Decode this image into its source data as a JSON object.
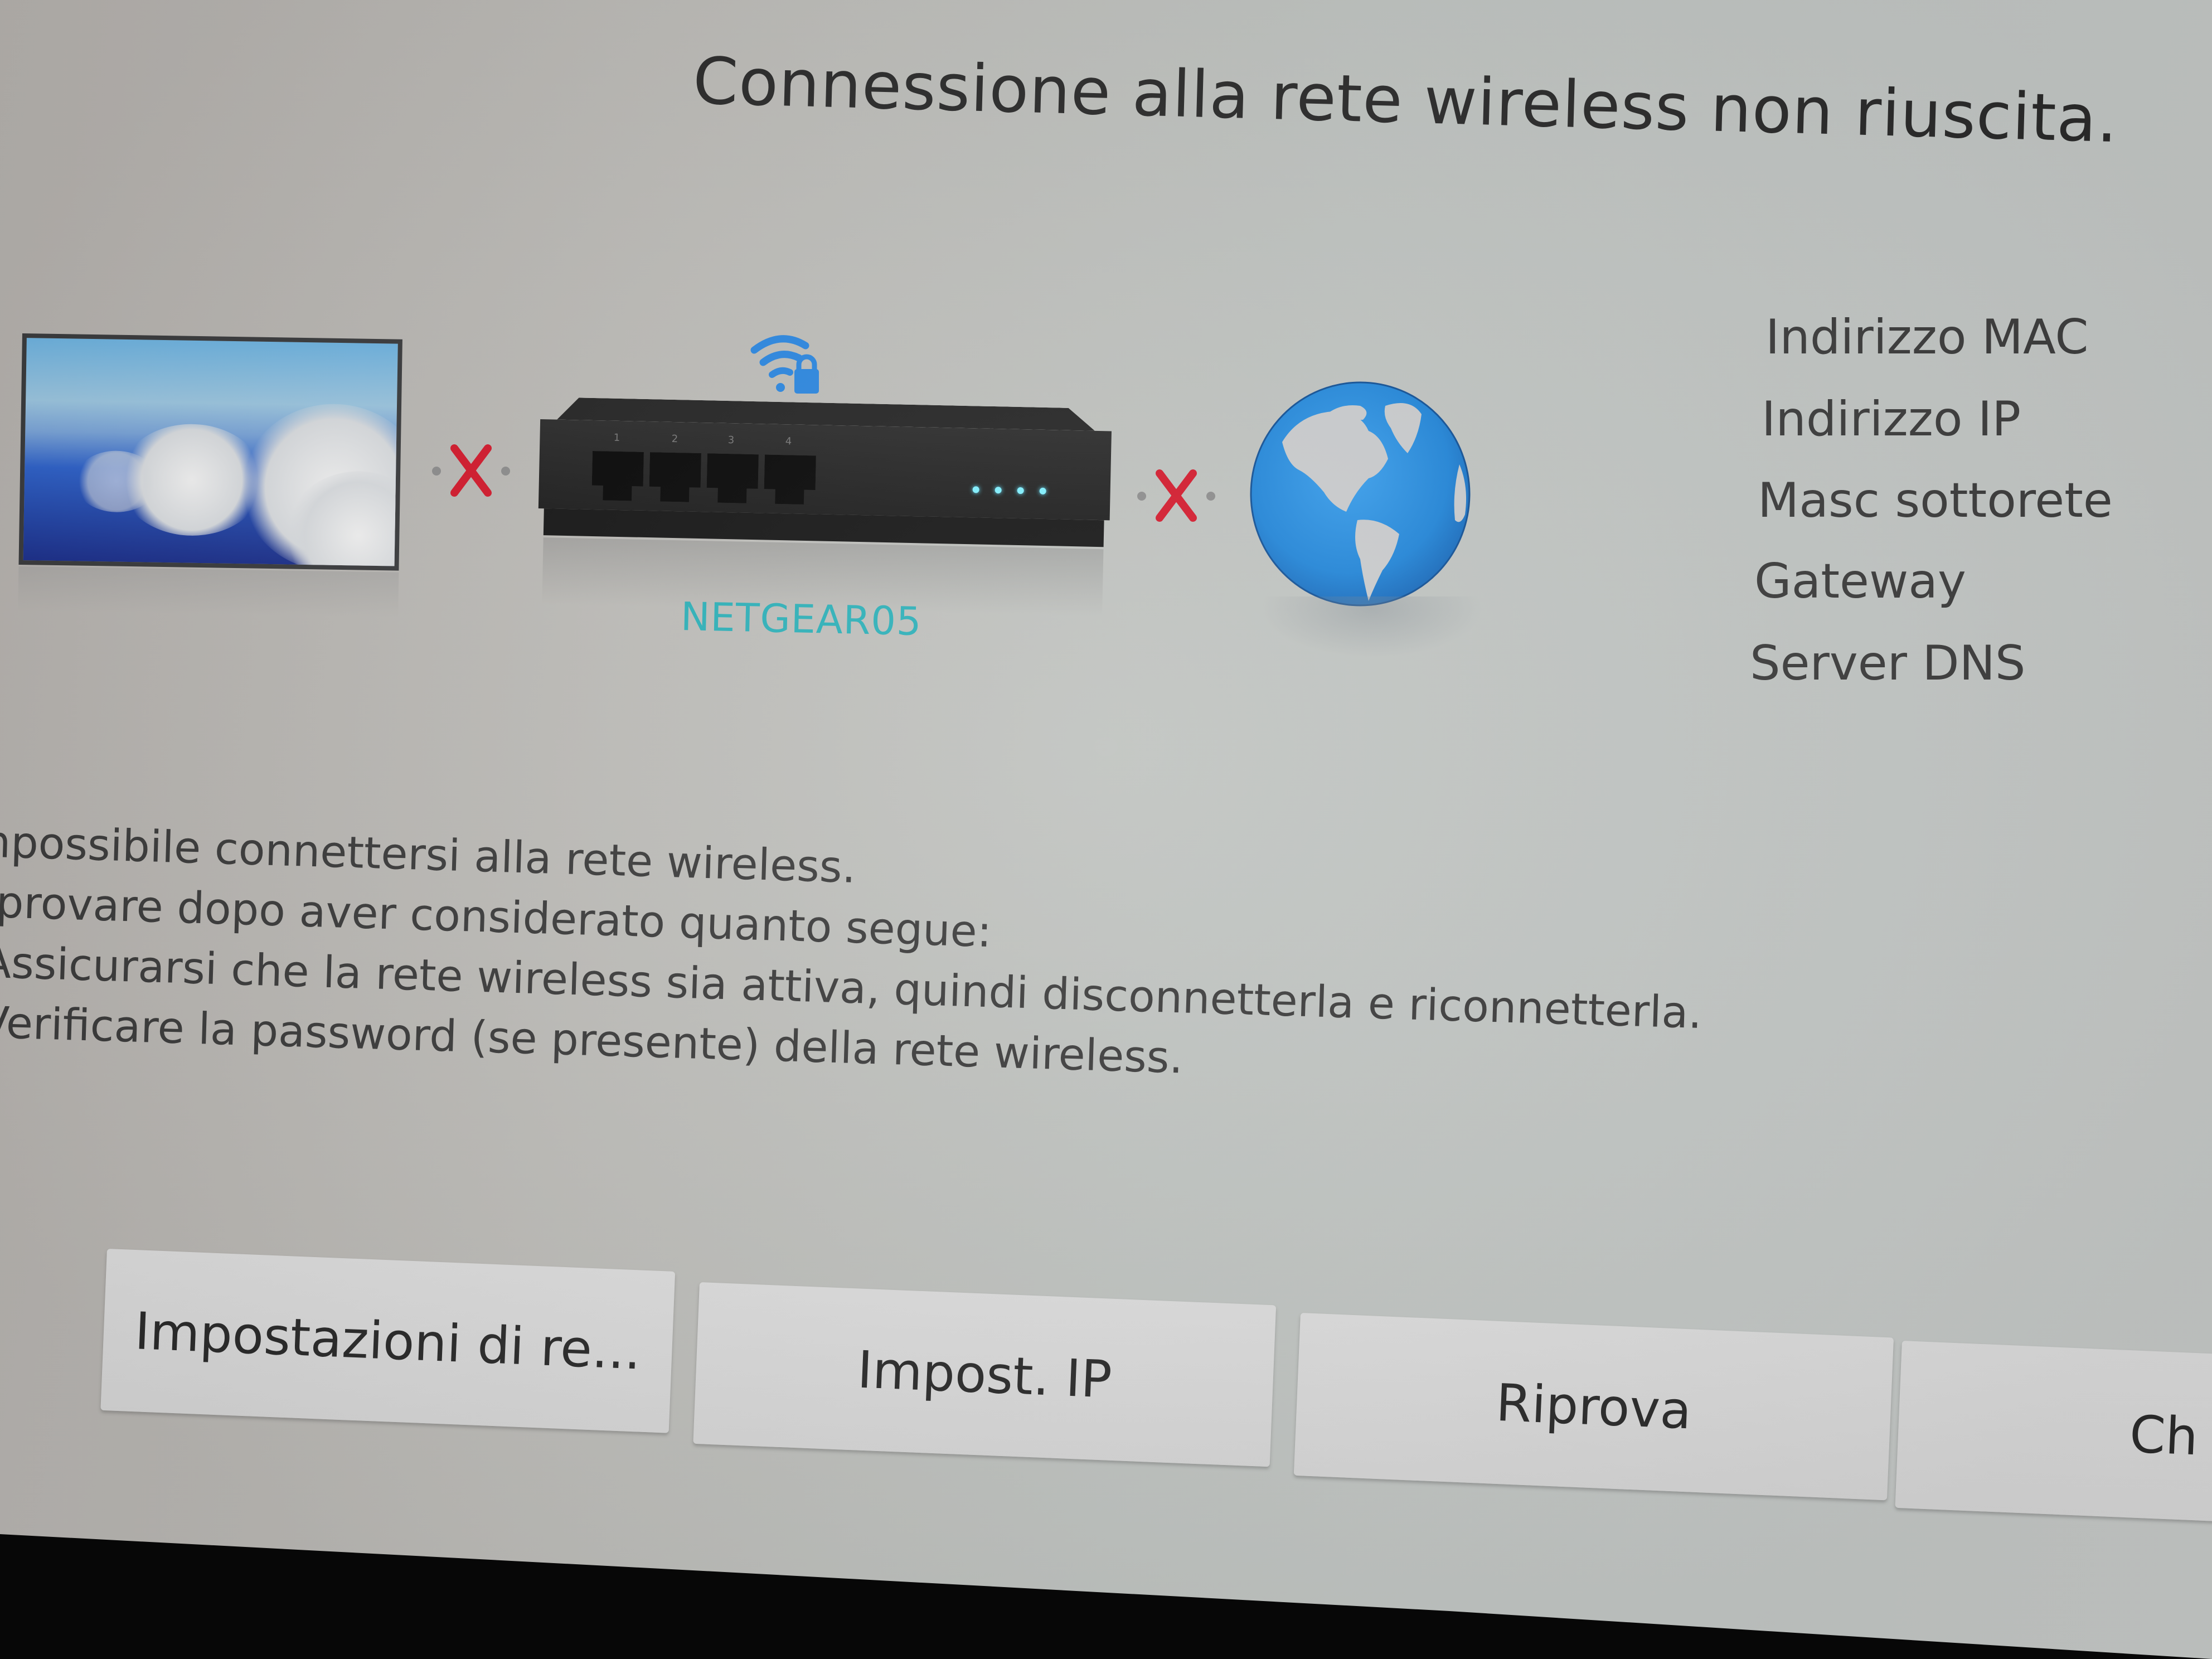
{
  "dialog": {
    "title": "Connessione alla rete wireless non riuscita."
  },
  "diagram": {
    "device_icon": "tv-icon",
    "link_status_1": "disconnected",
    "router_icon": "router-icon",
    "router_ports": [
      "1",
      "2",
      "3",
      "4"
    ],
    "wifi_icon": "wifi-lock-icon",
    "network_name": "NETGEAR05",
    "link_status_2": "disconnected",
    "internet_icon": "globe-icon",
    "accent_color": "#2bb0b8",
    "error_color": "#d3182b"
  },
  "network_info": {
    "items": [
      "Indirizzo MAC",
      "Indirizzo IP",
      "Masc sottorete",
      "Gateway",
      "Server DNS"
    ]
  },
  "message": {
    "lines": [
      "Impossibile connettersi alla rete wireless.",
      "Riprovare dopo aver considerato quanto segue:",
      "- Assicurarsi che la rete wireless sia attiva, quindi disconnetterla e riconnetterla.",
      "- Verificare la password (se presente) della rete wireless."
    ]
  },
  "buttons": {
    "network_settings": "Impostazioni di re...",
    "ip_settings": "Impost. IP",
    "retry": "Riprova",
    "close": "Ch"
  }
}
